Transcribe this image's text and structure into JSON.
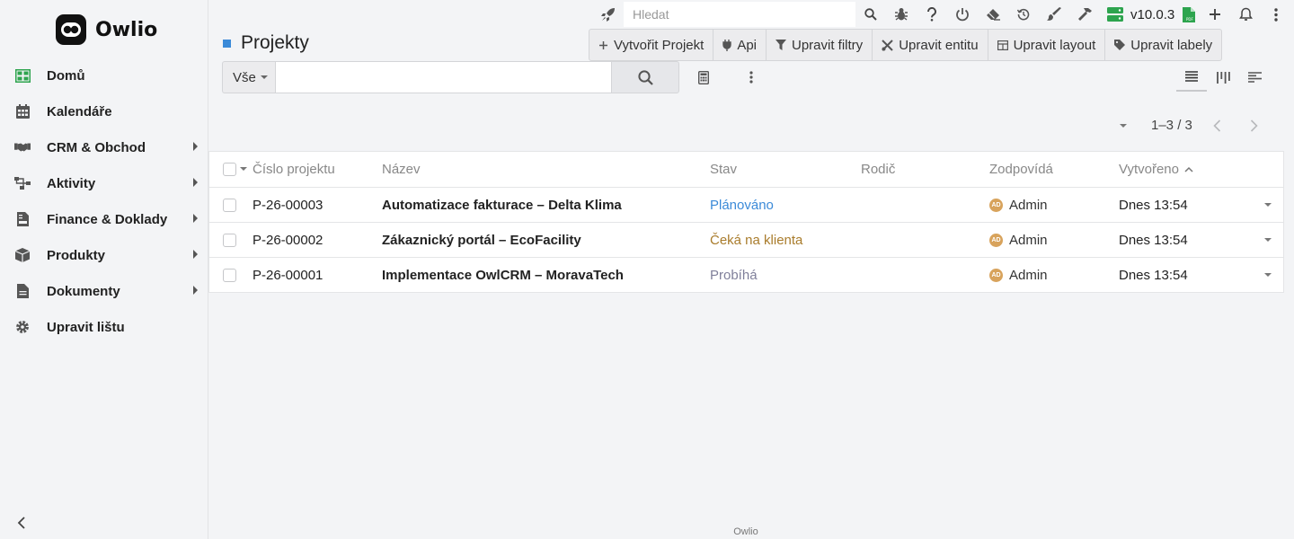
{
  "app": {
    "name": "Owlio",
    "footer": "Owlio"
  },
  "sidebar": {
    "items": [
      {
        "label": "Domů",
        "icon": "grid-icon",
        "color": "#2da44e",
        "submenu": false
      },
      {
        "label": "Kalendáře",
        "icon": "calendar-icon",
        "submenu": false
      },
      {
        "label": "CRM & Obchod",
        "icon": "handshake-icon",
        "submenu": true
      },
      {
        "label": "Aktivity",
        "icon": "sitemap-icon",
        "submenu": true
      },
      {
        "label": "Finance & Doklady",
        "icon": "invoice-icon",
        "submenu": true
      },
      {
        "label": "Produkty",
        "icon": "box-icon",
        "submenu": true
      },
      {
        "label": "Dokumenty",
        "icon": "file-icon",
        "submenu": true
      },
      {
        "label": "Upravit lištu",
        "icon": "gear-icon",
        "submenu": false
      }
    ]
  },
  "topbar": {
    "search_placeholder": "Hledat",
    "version": "v10.0.3"
  },
  "page": {
    "title": "Projekty",
    "accent": "#3b8ad8"
  },
  "actions": [
    {
      "label": "Vytvořit Projekt",
      "icon": "plus-icon"
    },
    {
      "label": "Api",
      "icon": "plug-icon"
    },
    {
      "label": "Upravit filtry",
      "icon": "filter-icon"
    },
    {
      "label": "Upravit entitu",
      "icon": "tools-icon"
    },
    {
      "label": "Upravit layout",
      "icon": "table-icon"
    },
    {
      "label": "Upravit labely",
      "icon": "tag-icon"
    }
  ],
  "filter": {
    "selected": "Vše",
    "value": ""
  },
  "pagination": {
    "text": "1–3 / 3"
  },
  "table": {
    "columns": [
      "Číslo projektu",
      "Název",
      "Stav",
      "Rodič",
      "Zodpovídá",
      "Vytvořeno"
    ],
    "sorted_column": "Vytvořeno",
    "rows": [
      {
        "number": "P-26-00003",
        "name": "Automatizace fakturace – Delta Klima",
        "status": "Plánováno",
        "status_color": "#3b8ad8",
        "parent": "",
        "avatar": "AD",
        "owner": "Admin",
        "created": "Dnes 13:54"
      },
      {
        "number": "P-26-00002",
        "name": "Zákaznický portál – EcoFacility",
        "status": "Čeká na klienta",
        "status_color": "#a97c2c",
        "parent": "",
        "avatar": "AD",
        "owner": "Admin",
        "created": "Dnes 13:54"
      },
      {
        "number": "P-26-00001",
        "name": "Implementace OwlCRM – MoravaTech",
        "status": "Probíhá",
        "status_color": "#7f7f9a",
        "parent": "",
        "avatar": "AD",
        "owner": "Admin",
        "created": "Dnes 13:54"
      }
    ]
  }
}
